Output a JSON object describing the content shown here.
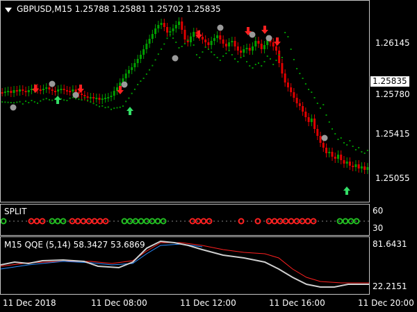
{
  "colors": {
    "background": "#000000",
    "border": "#c8c8c8",
    "bull": "#00a000",
    "bear": "#e00000",
    "trail": "#009900",
    "dot": "#9a9a9a",
    "up_arrow": "#33dd66",
    "down_arrow": "#ff2020",
    "qqe_fast": "#ff2020",
    "qqe_slow": "#2a8cff",
    "qqe_main": "#d0d0d0",
    "split_red": "#ff2020",
    "split_green": "#22c022"
  },
  "main": {
    "title": "GBPUSD,M15  1.25788 1.25881 1.25702 1.25835",
    "price_labels": [
      "1.26145",
      "1.25780",
      "1.25415",
      "1.25055"
    ],
    "current_price": "1.25835"
  },
  "split": {
    "name": "SPLIT",
    "levels": [
      "60",
      "30"
    ]
  },
  "qqe": {
    "title": "M15  QQE (5,14) 58.3427 53.6869",
    "levels": [
      "81.6431",
      "22.2151"
    ]
  },
  "time_axis": [
    "11 Dec 2018",
    "11 Dec 08:00",
    "11 Dec 12:00",
    "11 Dec 16:00",
    "11 Dec 20:00"
  ],
  "icons": {
    "up": "up-arrow-icon",
    "down": "down-arrow-icon",
    "dot": "grey-dot-icon",
    "ring": "ring-icon"
  }
}
